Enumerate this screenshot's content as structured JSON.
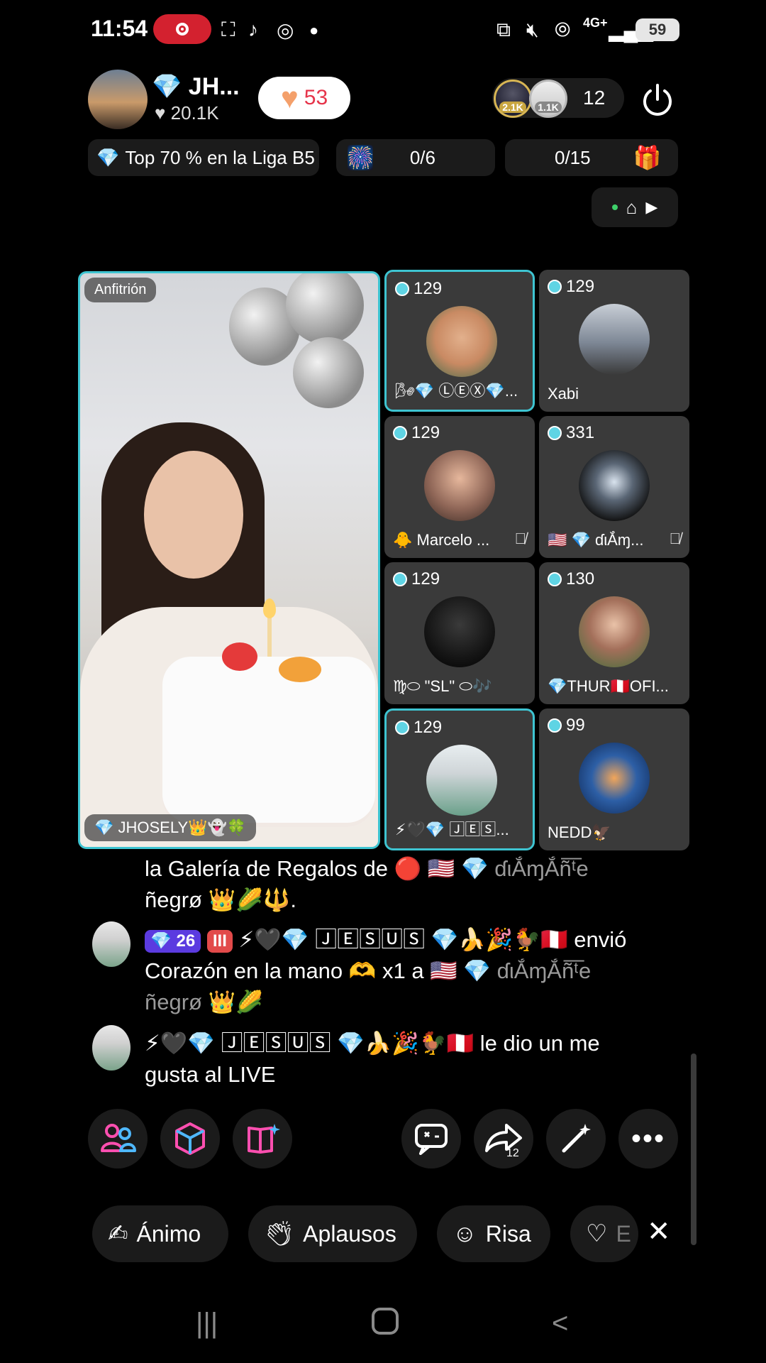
{
  "status_bar": {
    "time": "11:54",
    "network": "4G+",
    "battery": "59",
    "icons": [
      "screen-record-icon",
      "screenshot-icon",
      "tiktok-icon",
      "chrome-icon",
      "dot-icon",
      "cast-icon",
      "mute-icon",
      "hotspot-icon",
      "signal-icon"
    ]
  },
  "host": {
    "name": "💎 JH...",
    "likes_label": "♥ 20.1K",
    "like_count": "53"
  },
  "viewers": {
    "top1": "2.1K",
    "top2": "1.1K",
    "count": "12"
  },
  "info": {
    "league": "Top 70 % en la Liga B5",
    "goal1": "0/6",
    "goal2": "0/15"
  },
  "host_tile": {
    "tag": "Anfitrión",
    "name": "💎 JHOSELY👑👻🍀"
  },
  "guests": [
    {
      "score": "129",
      "name": "🌬💎 ⓁⒺⓍ💎...",
      "color": "#c98a63"
    },
    {
      "score": "129",
      "name": "Xabi",
      "color": "#7d8795"
    },
    {
      "score": "129",
      "name": "🐥 Marcelo ...",
      "color": "#8f6657"
    },
    {
      "score": "331",
      "name": "🇺🇸 💎 ɗιẮɱ...",
      "color": "#2b3139"
    },
    {
      "score": "129",
      "name": "♍⬭ \"SL\" ⬭🎶",
      "color": "#151515"
    },
    {
      "score": "130",
      "name": "💎THUR🇵🇪OFI...",
      "color": "#a36f5a"
    },
    {
      "score": "129",
      "name": "⚡🖤💎 🄹🄴🅂...",
      "color": "#cfd5d8"
    },
    {
      "score": "99",
      "name": "NEDD🦅",
      "color": "#2d5fa6"
    }
  ],
  "chat": {
    "msg1_line1": "la Galería de Regalos de 🔴 🇺🇸 💎",
    "msg1_dim1": "ɗιẮɱẮñ͞ᵗe",
    "msg1_line2": "ñegrø 👑🌽🔱.",
    "msg2_level": "💎 26",
    "msg2_badge": "III",
    "msg2_line1": "⚡🖤💎 🄹🄴🅂🅄🅂 💎🍌🎉🐓🇵🇪 envió",
    "msg2_line2": "Corazón en la mano 🫶 x1 a 🇺🇸 💎",
    "msg2_dim1": "ɗιẮɱẮñ͞ᵗe",
    "msg2_dim2": "ñegrø 👑🌽",
    "msg3_line1": "⚡🖤💎 🄹🄴🅂🅄🅂 💎🍌🎉🐓🇵🇪 le dio un me",
    "msg3_line2": "gusta al LIVE"
  },
  "toolbar": {
    "share_count": "12"
  },
  "reactions": {
    "animo": "Ánimo",
    "aplausos": "Aplausos",
    "risa": "Risa",
    "partial": "E"
  }
}
